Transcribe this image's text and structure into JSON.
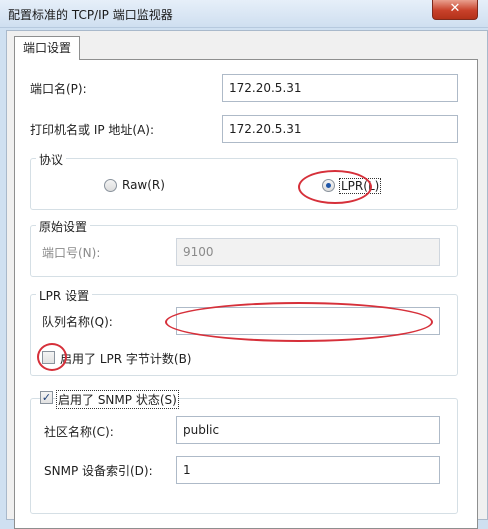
{
  "window": {
    "title": "配置标准的 TCP/IP 端口监视器",
    "close_symbol": "✕"
  },
  "tab": {
    "label": "端口设置"
  },
  "port_name": {
    "label": "端口名(P):",
    "value": "172.20.5.31"
  },
  "printer_address": {
    "label": "打印机名或 IP 地址(A):",
    "value": "172.20.5.31"
  },
  "protocol": {
    "group_label": "协议",
    "raw_label": "Raw(R)",
    "lpr_label": "LPR(L)",
    "selected": "LPR"
  },
  "raw_settings": {
    "group_label": "原始设置",
    "port_number_label": "端口号(N):",
    "port_number_value": "9100"
  },
  "lpr_settings": {
    "group_label": "LPR 设置",
    "queue_name_label": "队列名称(Q):",
    "queue_name_value": "",
    "byte_count_label": "启用了 LPR 字节计数(B)",
    "byte_count_checked": false
  },
  "snmp": {
    "enabled_label": "启用了 SNMP 状态(S)",
    "enabled_checked": true,
    "check_symbol": "✓",
    "community_label": "社区名称(C):",
    "community_value": "public",
    "device_index_label": "SNMP 设备索引(D):",
    "device_index_value": "1"
  },
  "annotation_color": "#d6303a"
}
